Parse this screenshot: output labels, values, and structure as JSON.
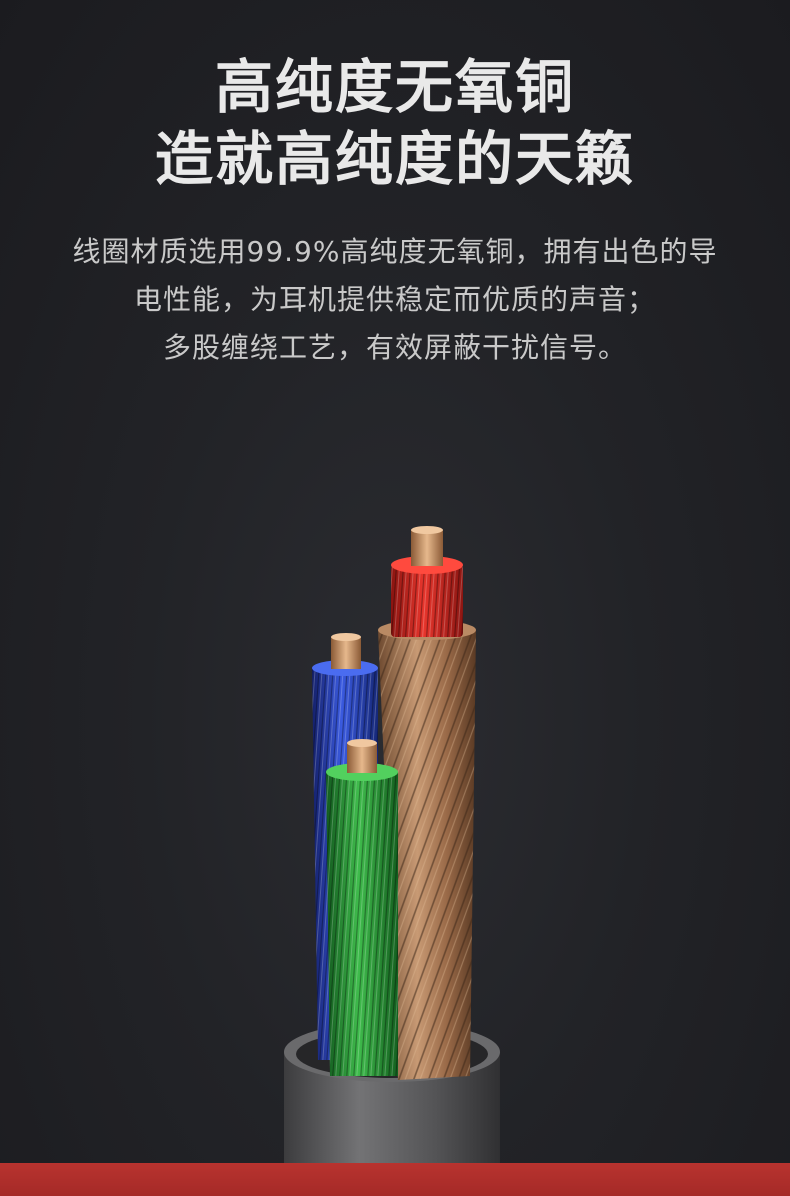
{
  "headline": {
    "line1": "高纯度无氧铜",
    "line2": "造就高纯度的天籁"
  },
  "description": {
    "line1": "线圈材质选用99.9%高纯度无氧铜，拥有出色的导",
    "line2": "电性能，为耳机提供稳定而优质的声音；",
    "line3": "多股缠绕工艺，有效屏蔽干扰信号。"
  },
  "colors": {
    "background": "#222327",
    "copper": "#b5805a",
    "red_insulation": "#d42a22",
    "blue_insulation": "#2a47c8",
    "green_insulation": "#2e9a3c",
    "jacket": "#5e5e60",
    "accent_bar": "#b8332f"
  }
}
